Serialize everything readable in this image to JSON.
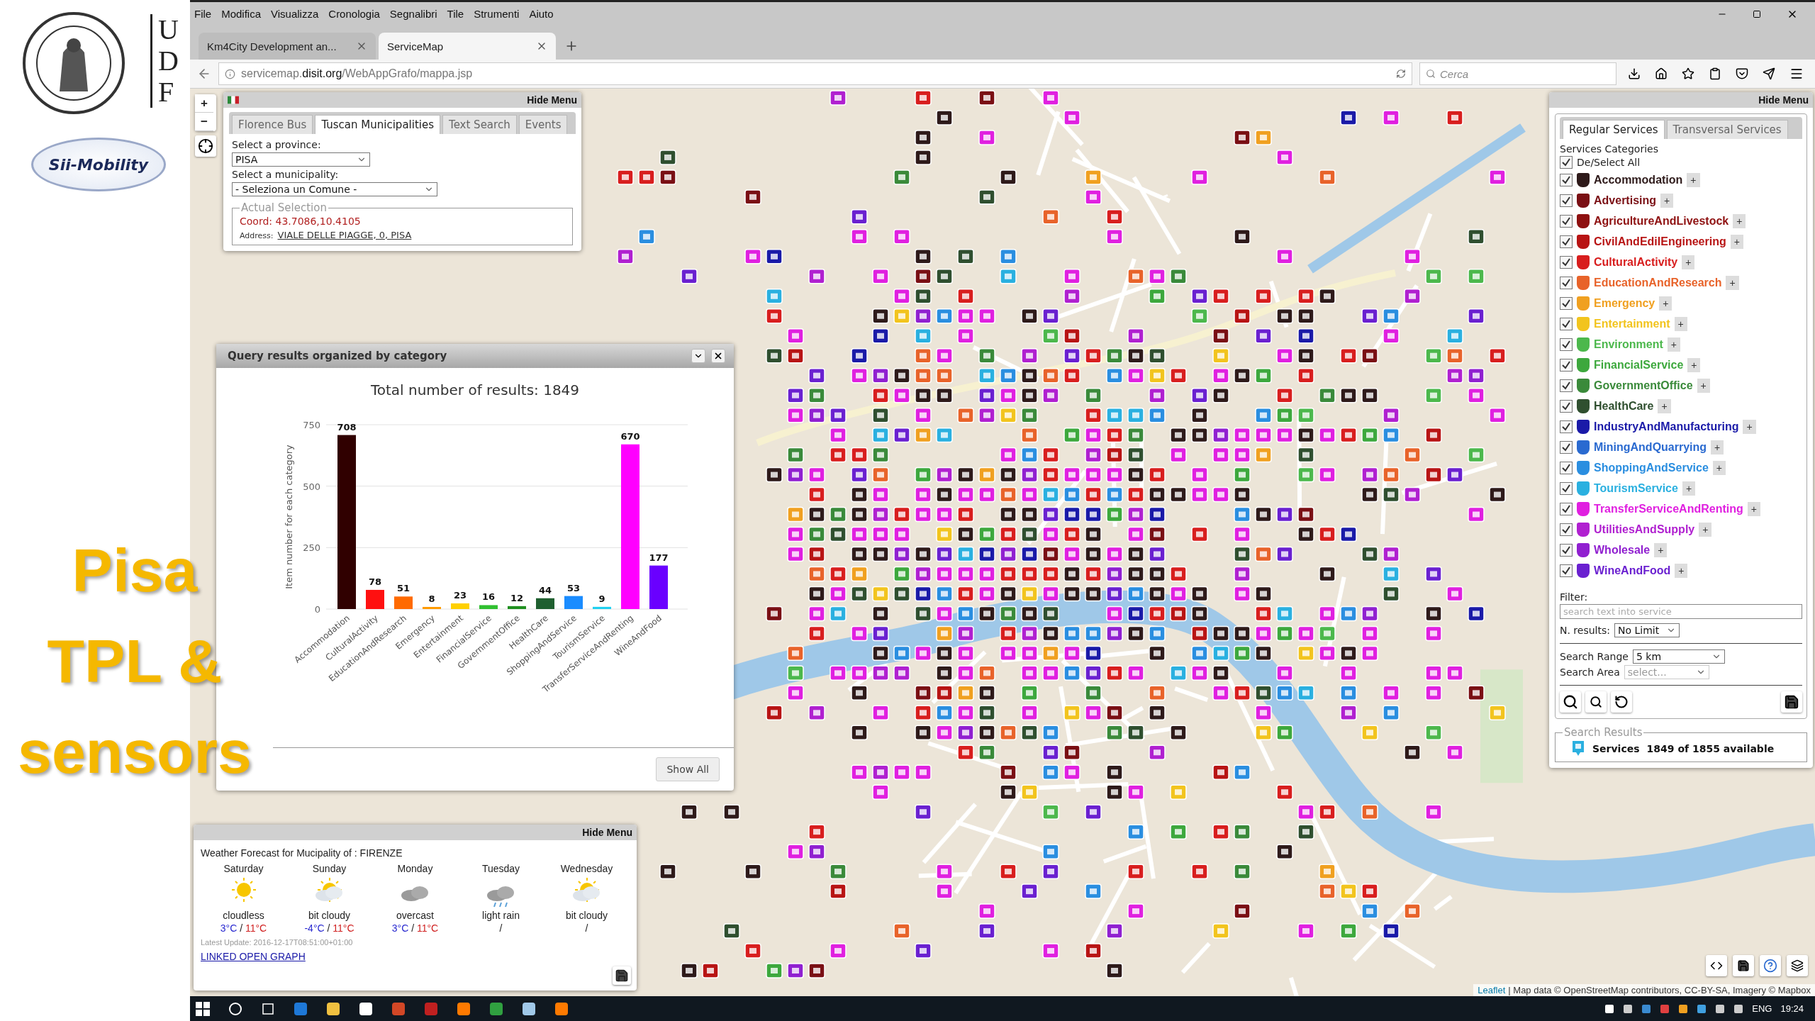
{
  "slide": {
    "university_letters": [
      "U",
      "D",
      "F"
    ],
    "logo_text": "Sii-Mobility",
    "title_lines": [
      "Pisa",
      "TPL &",
      "sensors"
    ]
  },
  "browser": {
    "menu": [
      "File",
      "Modifica",
      "Visualizza",
      "Cronologia",
      "Segnalibri",
      "Tile",
      "Strumenti",
      "Aiuto"
    ],
    "tabs": [
      {
        "title": "Km4City Development an...",
        "selected": false
      },
      {
        "title": "ServiceMap",
        "selected": true
      }
    ],
    "url": {
      "prefix": "servicemap.",
      "domain": "disit.org",
      "path": "/WebAppGrafo/mappa.jsp"
    },
    "search_placeholder": "Cerca"
  },
  "map": {
    "zoom_in": "+",
    "zoom_out": "−",
    "attribution_link": "Leaflet",
    "attribution": "| Map data © OpenStreetMap contributors, CC-BY-SA, Imagery © Mapbox"
  },
  "location_panel": {
    "hide": "Hide Menu",
    "tabs": [
      {
        "label": "Florence Bus",
        "selected": false
      },
      {
        "label": "Tuscan Municipalities",
        "selected": true
      },
      {
        "label": "Text Search",
        "selected": false
      },
      {
        "label": "Events",
        "selected": false
      }
    ],
    "province_label": "Select a province:",
    "province": "PISA",
    "municipality_label": "Select a municipality:",
    "municipality": "- Seleziona un Comune -",
    "selection_legend": "Actual Selection",
    "coord": "Coord: 43.7086,10.4105",
    "address_label": "Address:",
    "address": "VIALE DELLE PIAGGE, 0, PISA"
  },
  "results_panel": {
    "title": "Query results organized by category",
    "button": "Show All",
    "chart_data": {
      "type": "bar",
      "title": "Total number of results: 1849",
      "ylabel": "Item number for each category",
      "categories": [
        "Accommodation",
        "CulturalActivity",
        "EducationAndResearch",
        "Emergency",
        "Entertainment",
        "FinancialService",
        "GovernmentOffice",
        "HealthCare",
        "ShoppingAndService",
        "TourismService",
        "TransferServiceAndRenting",
        "WineAndFood"
      ],
      "series": [
        {
          "color": "#300000",
          "values": [
            708,
            null,
            null,
            null,
            null,
            null,
            null,
            null,
            null,
            null,
            null,
            null
          ]
        },
        {
          "color": "#ff1010",
          "values": [
            null,
            78,
            null,
            null,
            null,
            null,
            null,
            null,
            null,
            null,
            null,
            null
          ]
        },
        {
          "color": "#ff6a00",
          "values": [
            null,
            null,
            51,
            null,
            null,
            null,
            null,
            null,
            null,
            null,
            null,
            null
          ]
        },
        {
          "color": "#ff9a00",
          "values": [
            null,
            null,
            null,
            8,
            null,
            null,
            null,
            null,
            null,
            null,
            null,
            null
          ]
        },
        {
          "color": "#ffd000",
          "values": [
            null,
            null,
            null,
            null,
            23,
            null,
            null,
            null,
            null,
            null,
            null,
            null
          ]
        },
        {
          "color": "#30c030",
          "values": [
            null,
            null,
            null,
            null,
            null,
            16,
            null,
            null,
            null,
            null,
            null,
            null
          ]
        },
        {
          "color": "#209020",
          "values": [
            null,
            null,
            null,
            null,
            null,
            null,
            12,
            null,
            null,
            null,
            null,
            null
          ]
        },
        {
          "color": "#1f5f2f",
          "values": [
            null,
            null,
            null,
            null,
            null,
            null,
            null,
            44,
            null,
            null,
            null,
            null
          ]
        },
        {
          "color": "#1a8cff",
          "values": [
            null,
            null,
            null,
            null,
            null,
            null,
            null,
            null,
            53,
            null,
            null,
            null
          ]
        },
        {
          "color": "#20d0f0",
          "values": [
            null,
            null,
            null,
            null,
            null,
            null,
            null,
            null,
            null,
            9,
            null,
            null
          ]
        },
        {
          "color": "#ff00ff",
          "values": [
            null,
            null,
            null,
            null,
            null,
            null,
            null,
            null,
            null,
            null,
            670,
            null
          ]
        },
        {
          "color": "#6a00ff",
          "values": [
            null,
            null,
            null,
            null,
            null,
            null,
            null,
            null,
            null,
            null,
            null,
            177
          ]
        }
      ],
      "stacked": true,
      "ylim": [
        0,
        750
      ],
      "yticks": [
        0,
        250,
        500,
        750
      ],
      "data_labels": true
    }
  },
  "weather_panel": {
    "hide": "Hide Menu",
    "heading": "Weather Forecast for Mucipality of : FIRENZE",
    "days": [
      {
        "day": "Saturday",
        "kind": "sunny",
        "condition": "cloudless",
        "min": "3°C",
        "sep": "/",
        "max": "11°C"
      },
      {
        "day": "Sunday",
        "kind": "partly",
        "condition": "bit cloudy",
        "min": "-4°C",
        "sep": "/",
        "max": "11°C"
      },
      {
        "day": "Monday",
        "kind": "cloudy",
        "condition": "overcast",
        "min": "3°C",
        "sep": "/",
        "max": "11°C"
      },
      {
        "day": "Tuesday",
        "kind": "rain",
        "condition": "light rain",
        "no_temp": "/"
      },
      {
        "day": "Wednesday",
        "kind": "partly",
        "condition": "bit cloudy",
        "no_temp": "/"
      }
    ],
    "update": "Latest Update: 2016-12-17T08:51:00+01:00",
    "link": "LINKED OPEN GRAPH"
  },
  "services_panel": {
    "hide": "Hide Menu",
    "tabs": [
      {
        "label": "Regular Services",
        "selected": true
      },
      {
        "label": "Transversal Services",
        "selected": false
      }
    ],
    "heading": "Services Categories",
    "select_all": {
      "label": "De/Select All",
      "checked": true
    },
    "categories": [
      {
        "name": "Accommodation",
        "color": "#2e1a1a",
        "checked": true,
        "expand": "+"
      },
      {
        "name": "Advertising",
        "color": "#7a0f14",
        "checked": true,
        "expand": "+"
      },
      {
        "name": "AgricultureAndLivestock",
        "color": "#8e1010",
        "checked": true,
        "expand": "+"
      },
      {
        "name": "CivilAndEdilEngineering",
        "color": "#b81414",
        "checked": true,
        "expand": "+"
      },
      {
        "name": "CulturalActivity",
        "color": "#d81e1e",
        "checked": true,
        "expand": "+"
      },
      {
        "name": "EducationAndResearch",
        "color": "#e8632a",
        "checked": true,
        "expand": "+"
      },
      {
        "name": "Emergency",
        "color": "#f0a020",
        "checked": true,
        "expand": "+"
      },
      {
        "name": "Entertainment",
        "color": "#f2c41e",
        "checked": true,
        "expand": "+"
      },
      {
        "name": "Environment",
        "color": "#4cb84c",
        "checked": true,
        "expand": "+"
      },
      {
        "name": "FinancialService",
        "color": "#3da83d",
        "checked": true,
        "expand": "+"
      },
      {
        "name": "GovernmentOffice",
        "color": "#3a8a3a",
        "checked": true,
        "expand": "+"
      },
      {
        "name": "HealthCare",
        "color": "#2f4f2f",
        "checked": true,
        "expand": "+"
      },
      {
        "name": "IndustryAndManufacturing",
        "color": "#1a1aa8",
        "checked": true,
        "expand": "+"
      },
      {
        "name": "MiningAndQuarrying",
        "color": "#2a6ad0",
        "checked": true,
        "expand": "+"
      },
      {
        "name": "ShoppingAndService",
        "color": "#2a8ee0",
        "checked": true,
        "expand": "+"
      },
      {
        "name": "TourismService",
        "color": "#2ab0e0",
        "checked": true,
        "expand": "+"
      },
      {
        "name": "TransferServiceAndRenting",
        "color": "#e020e0",
        "checked": true,
        "expand": "+"
      },
      {
        "name": "UtilitiesAndSupply",
        "color": "#b020d0",
        "checked": true,
        "expand": "+"
      },
      {
        "name": "Wholesale",
        "color": "#9020d0",
        "checked": true,
        "expand": "+"
      },
      {
        "name": "WineAndFood",
        "color": "#6a20d0",
        "checked": true,
        "expand": "+"
      }
    ],
    "filter_label": "Filter:",
    "filter_placeholder": "search text into service",
    "n_results_label": "N. results:",
    "n_results": "No Limit",
    "range_label": "Search Range",
    "range": "5 km",
    "area_label": "Search Area",
    "area_placeholder": "select...",
    "results_legend": "Search Results",
    "results_name": "Services",
    "results_count": "1849 of 1855 available"
  },
  "taskbar": {
    "language": "ENG",
    "time": "19:24"
  }
}
